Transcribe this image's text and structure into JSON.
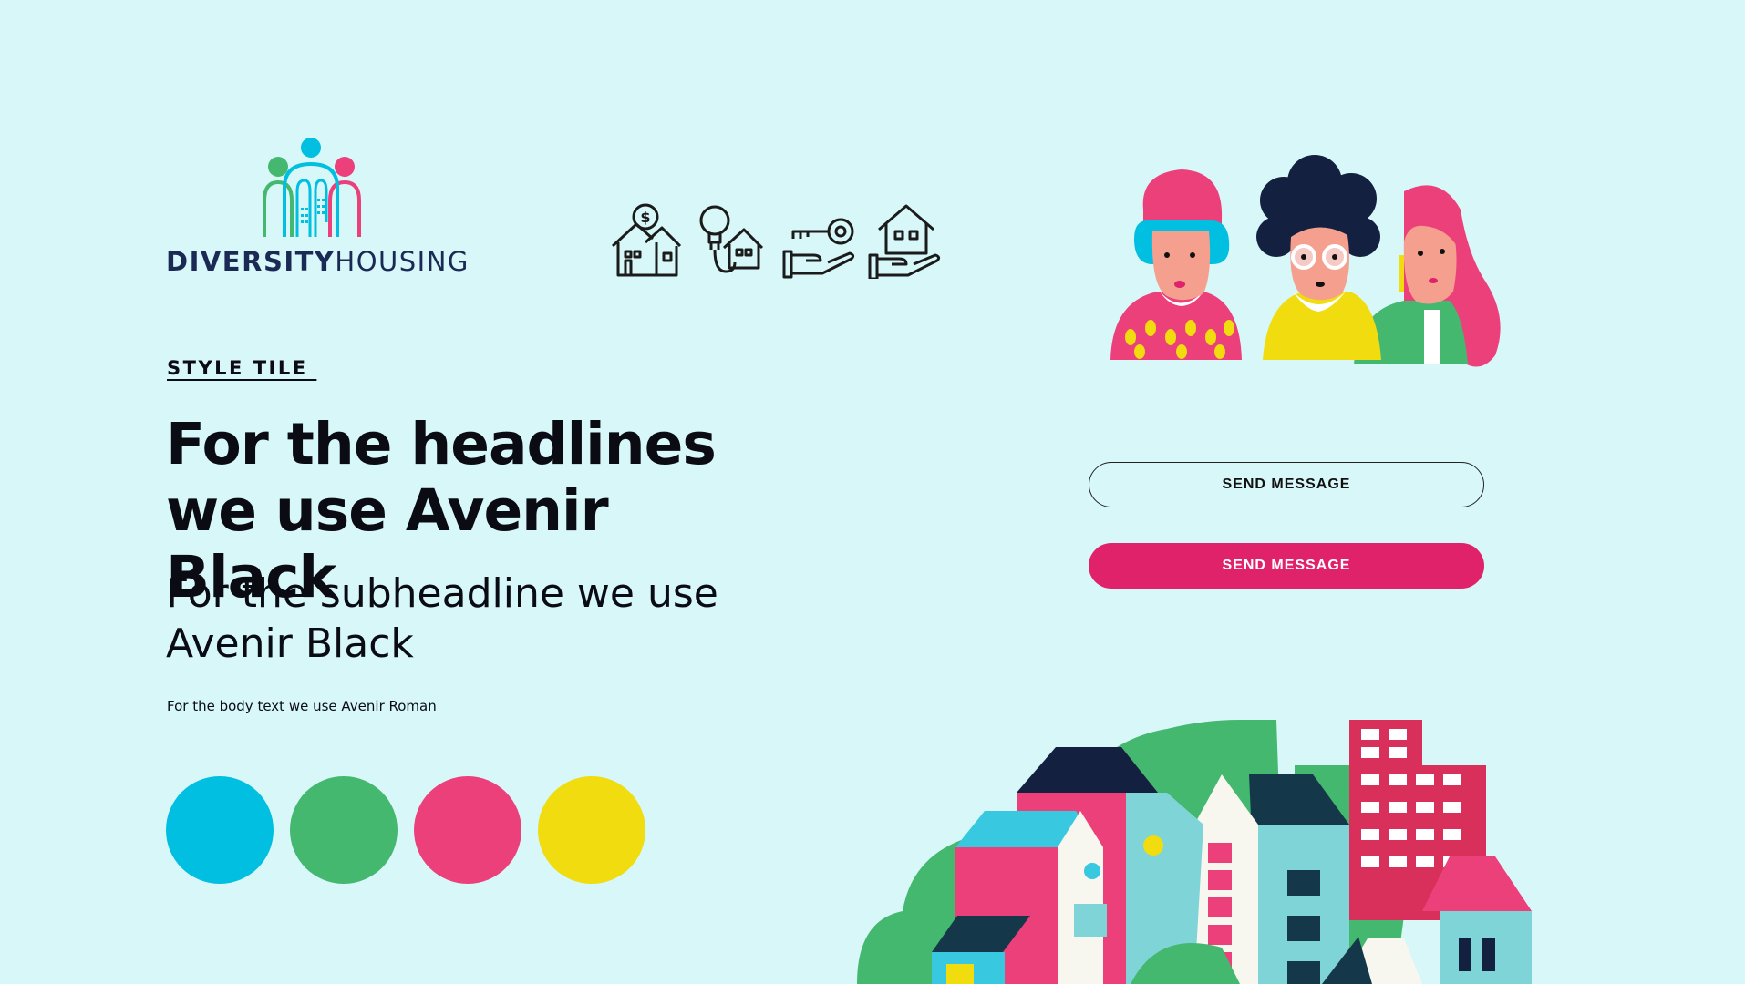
{
  "logo": {
    "bold": "DIVERSITY",
    "light": "HOUSING"
  },
  "style_tile_label": "STYLE TILE ",
  "headline": "For the headlines we use Avenir Black",
  "subheadline": "For the subheadline we use Avenir Black",
  "body_text": "For the body text we use Avenir Roman",
  "palette": [
    "#00bfe0",
    "#44b86e",
    "#ec407a",
    "#f0dc0f"
  ],
  "buttons": {
    "outline_label": "SEND MESSAGE",
    "filled_label": "SEND MESSAGE"
  },
  "icons": [
    "house-coin-icon",
    "lightbulb-house-icon",
    "hand-key-icon",
    "hand-house-icon"
  ]
}
